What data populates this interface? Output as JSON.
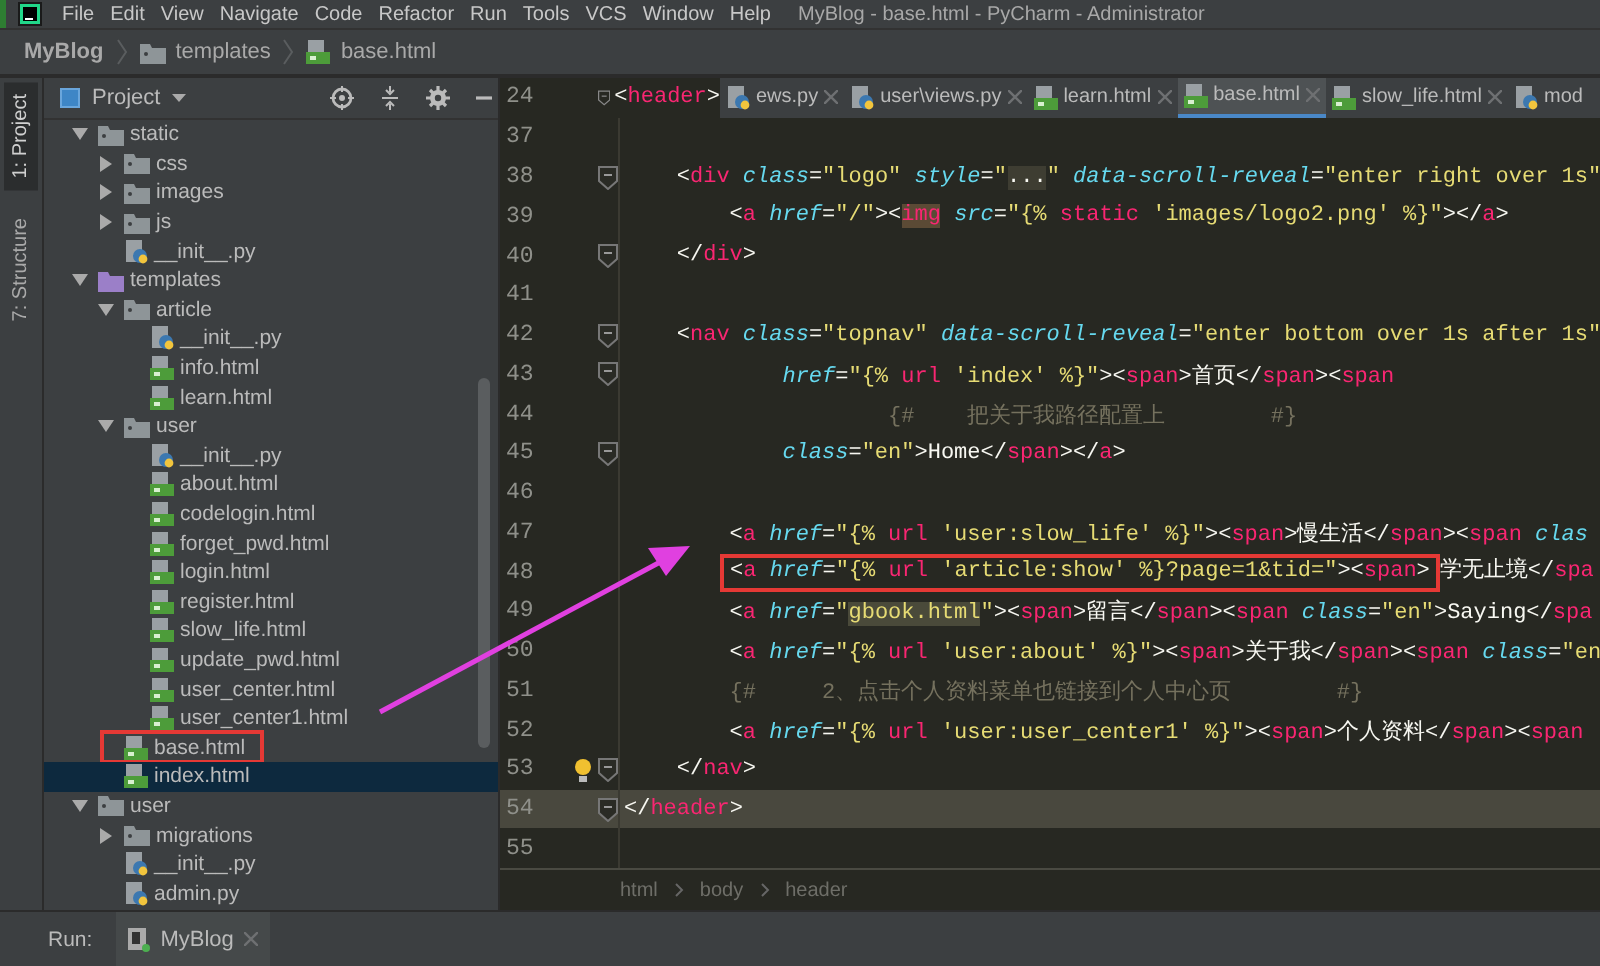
{
  "window": {
    "title": "MyBlog - base.html - PyCharm - Administrator"
  },
  "menu": [
    "File",
    "Edit",
    "View",
    "Navigate",
    "Code",
    "Refactor",
    "Run",
    "Tools",
    "VCS",
    "Window",
    "Help"
  ],
  "breadcrumb": [
    {
      "label": "MyBlog",
      "kind": "project"
    },
    {
      "label": "templates",
      "kind": "folder"
    },
    {
      "label": "base.html",
      "kind": "html"
    }
  ],
  "tool_stripe": [
    {
      "label": "1: Project",
      "selected": true
    },
    {
      "label": "7: Structure",
      "selected": false
    }
  ],
  "project_panel": {
    "title": "Project",
    "tree": [
      {
        "label": "static",
        "kind": "folder",
        "expanded": true,
        "selected": false,
        "marked": false,
        "children": [
          {
            "label": "css",
            "kind": "folder",
            "expanded": false,
            "selected": false,
            "marked": false
          },
          {
            "label": "images",
            "kind": "folder",
            "expanded": false,
            "selected": false,
            "marked": false
          },
          {
            "label": "js",
            "kind": "folder",
            "expanded": false,
            "selected": false,
            "marked": false
          },
          {
            "label": "__init__.py",
            "kind": "python",
            "selected": false,
            "marked": false
          }
        ]
      },
      {
        "label": "templates",
        "kind": "templates-folder",
        "expanded": true,
        "selected": false,
        "marked": false,
        "children": [
          {
            "label": "article",
            "kind": "folder",
            "expanded": true,
            "selected": false,
            "marked": false,
            "children": [
              {
                "label": "__init__.py",
                "kind": "python",
                "selected": false,
                "marked": false
              },
              {
                "label": "info.html",
                "kind": "html",
                "selected": false,
                "marked": false
              },
              {
                "label": "learn.html",
                "kind": "html",
                "selected": false,
                "marked": false
              }
            ]
          },
          {
            "label": "user",
            "kind": "folder",
            "expanded": true,
            "selected": false,
            "marked": false,
            "children": [
              {
                "label": "__init__.py",
                "kind": "python",
                "selected": false,
                "marked": false
              },
              {
                "label": "about.html",
                "kind": "html",
                "selected": false,
                "marked": false
              },
              {
                "label": "codelogin.html",
                "kind": "html",
                "selected": false,
                "marked": false
              },
              {
                "label": "forget_pwd.html",
                "kind": "html",
                "selected": false,
                "marked": false
              },
              {
                "label": "login.html",
                "kind": "html",
                "selected": false,
                "marked": false
              },
              {
                "label": "register.html",
                "kind": "html",
                "selected": false,
                "marked": false
              },
              {
                "label": "slow_life.html",
                "kind": "html",
                "selected": false,
                "marked": false
              },
              {
                "label": "update_pwd.html",
                "kind": "html",
                "selected": false,
                "marked": false
              },
              {
                "label": "user_center.html",
                "kind": "html",
                "selected": false,
                "marked": false
              },
              {
                "label": "user_center1.html",
                "kind": "html",
                "selected": false,
                "marked": false
              }
            ]
          },
          {
            "label": "base.html",
            "kind": "html",
            "selected": false,
            "marked": true
          },
          {
            "label": "index.html",
            "kind": "html",
            "selected": true,
            "marked": false
          }
        ]
      },
      {
        "label": "user",
        "kind": "folder",
        "expanded": true,
        "selected": false,
        "marked": false,
        "children": [
          {
            "label": "migrations",
            "kind": "folder",
            "expanded": false,
            "selected": false,
            "marked": false
          },
          {
            "label": "__init__.py",
            "kind": "python",
            "selected": false,
            "marked": false
          },
          {
            "label": "admin.py",
            "kind": "python",
            "selected": false,
            "marked": false
          }
        ]
      }
    ]
  },
  "editor": {
    "sticky_line": {
      "number": "24",
      "tokens": [
        {
          "kind": "punct",
          "text": "<"
        },
        {
          "kind": "tag",
          "text": "header"
        },
        {
          "kind": "punct",
          "text": ">"
        }
      ]
    },
    "tabs": [
      {
        "label": "ews.py",
        "kind": "python",
        "selected": false,
        "closable": true
      },
      {
        "label": "user\\views.py",
        "kind": "python",
        "selected": false,
        "closable": true
      },
      {
        "label": "learn.html",
        "kind": "html",
        "selected": false,
        "closable": true
      },
      {
        "label": "base.html",
        "kind": "html",
        "selected": true,
        "closable": true
      },
      {
        "label": "slow_life.html",
        "kind": "html",
        "selected": false,
        "closable": true
      },
      {
        "label": "mod",
        "kind": "python",
        "selected": false,
        "closable": false
      }
    ],
    "lines": [
      {
        "number": "37",
        "fold": false,
        "bulb": false,
        "current": false
      },
      {
        "number": "38",
        "fold": true,
        "bulb": false,
        "current": false,
        "tokens": [
          {
            "kind": "punct",
            "text": "    <"
          },
          {
            "kind": "tag",
            "text": "div "
          },
          {
            "kind": "attr",
            "text": "class"
          },
          {
            "kind": "punct",
            "text": "="
          },
          {
            "kind": "string",
            "text": "\"logo\" "
          },
          {
            "kind": "attr",
            "text": "style"
          },
          {
            "kind": "punct",
            "text": "="
          },
          {
            "kind": "string",
            "text": "\""
          },
          {
            "kind": "folded",
            "text": "..."
          },
          {
            "kind": "string",
            "text": "\" "
          },
          {
            "kind": "attr",
            "text": "data-scroll-reveal"
          },
          {
            "kind": "punct",
            "text": "="
          },
          {
            "kind": "string",
            "text": "\"enter right over 1s\""
          }
        ]
      },
      {
        "number": "39",
        "fold": false,
        "bulb": false,
        "current": false,
        "tokens": [
          {
            "kind": "punct",
            "text": "        <"
          },
          {
            "kind": "tag",
            "text": "a "
          },
          {
            "kind": "attr",
            "text": "href"
          },
          {
            "kind": "punct",
            "text": "="
          },
          {
            "kind": "string",
            "text": "\"/\""
          },
          {
            "kind": "punct",
            "text": "><"
          },
          {
            "kind": "tag-marked",
            "text": "img"
          },
          {
            "kind": "attr",
            "text": " src"
          },
          {
            "kind": "punct",
            "text": "="
          },
          {
            "kind": "string",
            "text": "\"{% "
          },
          {
            "kind": "tag",
            "text": "static "
          },
          {
            "kind": "string",
            "text": "'images/logo2.png' %}\""
          },
          {
            "kind": "punct",
            "text": "></"
          },
          {
            "kind": "tag",
            "text": "a"
          },
          {
            "kind": "punct",
            "text": ">"
          }
        ]
      },
      {
        "number": "40",
        "fold": true,
        "bulb": false,
        "current": false,
        "tokens": [
          {
            "kind": "punct",
            "text": "    </"
          },
          {
            "kind": "tag",
            "text": "div"
          },
          {
            "kind": "punct",
            "text": ">"
          }
        ]
      },
      {
        "number": "41",
        "fold": false,
        "bulb": false,
        "current": false
      },
      {
        "number": "42",
        "fold": true,
        "bulb": false,
        "current": false,
        "tokens": [
          {
            "kind": "punct",
            "text": "    <"
          },
          {
            "kind": "tag",
            "text": "nav "
          },
          {
            "kind": "attr",
            "text": "class"
          },
          {
            "kind": "punct",
            "text": "="
          },
          {
            "kind": "string",
            "text": "\"topnav\" "
          },
          {
            "kind": "attr",
            "text": "data-scroll-reveal"
          },
          {
            "kind": "punct",
            "text": "="
          },
          {
            "kind": "string",
            "text": "\"enter bottom over 1s after 1s\""
          }
        ]
      },
      {
        "number": "43",
        "fold": true,
        "bulb": false,
        "current": false,
        "tokens": [
          {
            "kind": "attr",
            "text": "            href"
          },
          {
            "kind": "punct",
            "text": "="
          },
          {
            "kind": "string",
            "text": "\"{% "
          },
          {
            "kind": "tag",
            "text": "url "
          },
          {
            "kind": "string",
            "text": "'index' %}\""
          },
          {
            "kind": "punct",
            "text": "><"
          },
          {
            "kind": "tag",
            "text": "span"
          },
          {
            "kind": "punct",
            "text": ">"
          },
          {
            "kind": "text",
            "text": "首页"
          },
          {
            "kind": "punct",
            "text": "</"
          },
          {
            "kind": "tag",
            "text": "span"
          },
          {
            "kind": "punct",
            "text": "><"
          },
          {
            "kind": "tag",
            "text": "span"
          }
        ]
      },
      {
        "number": "44",
        "fold": false,
        "bulb": false,
        "current": false,
        "tokens": [
          {
            "kind": "comment",
            "text": "                    {#    把关于我路径配置上        #}"
          }
        ]
      },
      {
        "number": "45",
        "fold": true,
        "bulb": false,
        "current": false,
        "tokens": [
          {
            "kind": "attr",
            "text": "            class"
          },
          {
            "kind": "punct",
            "text": "="
          },
          {
            "kind": "string",
            "text": "\"en\""
          },
          {
            "kind": "punct",
            "text": ">"
          },
          {
            "kind": "text",
            "text": "Home"
          },
          {
            "kind": "punct",
            "text": "</"
          },
          {
            "kind": "tag",
            "text": "span"
          },
          {
            "kind": "punct",
            "text": "></"
          },
          {
            "kind": "tag",
            "text": "a"
          },
          {
            "kind": "punct",
            "text": ">"
          }
        ]
      },
      {
        "number": "46",
        "fold": false,
        "bulb": false,
        "current": false
      },
      {
        "number": "47",
        "fold": false,
        "bulb": false,
        "current": false,
        "tokens": [
          {
            "kind": "punct",
            "text": "        <"
          },
          {
            "kind": "tag",
            "text": "a "
          },
          {
            "kind": "attr",
            "text": "href"
          },
          {
            "kind": "punct",
            "text": "="
          },
          {
            "kind": "string",
            "text": "\"{% "
          },
          {
            "kind": "tag",
            "text": "url "
          },
          {
            "kind": "string",
            "text": "'user:slow_life' %}\""
          },
          {
            "kind": "punct",
            "text": "><"
          },
          {
            "kind": "tag",
            "text": "span"
          },
          {
            "kind": "punct",
            "text": ">"
          },
          {
            "kind": "text",
            "text": "慢生活"
          },
          {
            "kind": "punct",
            "text": "</"
          },
          {
            "kind": "tag",
            "text": "span"
          },
          {
            "kind": "punct",
            "text": "><"
          },
          {
            "kind": "tag",
            "text": "span "
          },
          {
            "kind": "attr",
            "text": "clas"
          }
        ]
      },
      {
        "number": "48",
        "fold": false,
        "bulb": false,
        "current": false,
        "tokens": [
          {
            "kind": "callout",
            "tokens": [
              {
                "kind": "punct",
                "text": "<"
              },
              {
                "kind": "tag",
                "text": "a "
              },
              {
                "kind": "attr",
                "text": "href"
              },
              {
                "kind": "punct",
                "text": "="
              },
              {
                "kind": "string",
                "text": "\"{% "
              },
              {
                "kind": "tag",
                "text": "url "
              },
              {
                "kind": "string",
                "text": "'article:show' %}?page=1&tid=\""
              },
              {
                "kind": "punct",
                "text": "><"
              },
              {
                "kind": "tag",
                "text": "span"
              },
              {
                "kind": "punct",
                "text": ">"
              }
            ]
          },
          {
            "kind": "text",
            "text": "学无止境"
          },
          {
            "kind": "punct",
            "text": "</"
          },
          {
            "kind": "tag",
            "text": "spa"
          }
        ]
      },
      {
        "number": "49",
        "fold": false,
        "bulb": false,
        "current": false,
        "tokens": [
          {
            "kind": "punct",
            "text": "        <"
          },
          {
            "kind": "tag",
            "text": "a "
          },
          {
            "kind": "attr",
            "text": "href"
          },
          {
            "kind": "punct",
            "text": "="
          },
          {
            "kind": "string",
            "text": "\""
          },
          {
            "kind": "string-marked",
            "text": "gbook.html"
          },
          {
            "kind": "string",
            "text": "\""
          },
          {
            "kind": "punct",
            "text": "><"
          },
          {
            "kind": "tag",
            "text": "span"
          },
          {
            "kind": "punct",
            "text": ">"
          },
          {
            "kind": "text",
            "text": "留言"
          },
          {
            "kind": "punct",
            "text": "</"
          },
          {
            "kind": "tag",
            "text": "span"
          },
          {
            "kind": "punct",
            "text": "><"
          },
          {
            "kind": "tag",
            "text": "span "
          },
          {
            "kind": "attr",
            "text": "class"
          },
          {
            "kind": "punct",
            "text": "="
          },
          {
            "kind": "string",
            "text": "\"en\""
          },
          {
            "kind": "punct",
            "text": ">"
          },
          {
            "kind": "text",
            "text": "Saying"
          },
          {
            "kind": "punct",
            "text": "</"
          },
          {
            "kind": "tag",
            "text": "spa"
          }
        ]
      },
      {
        "number": "50",
        "fold": false,
        "bulb": false,
        "current": false,
        "tokens": [
          {
            "kind": "punct",
            "text": "        <"
          },
          {
            "kind": "tag",
            "text": "a "
          },
          {
            "kind": "attr",
            "text": "href"
          },
          {
            "kind": "punct",
            "text": "="
          },
          {
            "kind": "string",
            "text": "\"{% "
          },
          {
            "kind": "tag",
            "text": "url "
          },
          {
            "kind": "string",
            "text": "'user:about' %}\""
          },
          {
            "kind": "punct",
            "text": "><"
          },
          {
            "kind": "tag",
            "text": "span"
          },
          {
            "kind": "punct",
            "text": ">"
          },
          {
            "kind": "text",
            "text": "关于我"
          },
          {
            "kind": "punct",
            "text": "</"
          },
          {
            "kind": "tag",
            "text": "span"
          },
          {
            "kind": "punct",
            "text": "><"
          },
          {
            "kind": "tag",
            "text": "span "
          },
          {
            "kind": "attr",
            "text": "class"
          },
          {
            "kind": "punct",
            "text": "="
          },
          {
            "kind": "string",
            "text": "\"en"
          }
        ]
      },
      {
        "number": "51",
        "fold": false,
        "bulb": false,
        "current": false,
        "tokens": [
          {
            "kind": "comment",
            "text": "        {#     2、点击个人资料菜单也链接到个人中心页        #}"
          }
        ]
      },
      {
        "number": "52",
        "fold": false,
        "bulb": false,
        "current": false,
        "tokens": [
          {
            "kind": "punct",
            "text": "        <"
          },
          {
            "kind": "tag",
            "text": "a "
          },
          {
            "kind": "attr",
            "text": "href"
          },
          {
            "kind": "punct",
            "text": "="
          },
          {
            "kind": "string",
            "text": "\"{% "
          },
          {
            "kind": "tag",
            "text": "url "
          },
          {
            "kind": "string",
            "text": "'user:user_center1' %}\""
          },
          {
            "kind": "punct",
            "text": "><"
          },
          {
            "kind": "tag",
            "text": "span"
          },
          {
            "kind": "punct",
            "text": ">"
          },
          {
            "kind": "text",
            "text": "个人资料"
          },
          {
            "kind": "punct",
            "text": "</"
          },
          {
            "kind": "tag",
            "text": "span"
          },
          {
            "kind": "punct",
            "text": "><"
          },
          {
            "kind": "tag",
            "text": "span"
          }
        ]
      },
      {
        "number": "53",
        "fold": true,
        "bulb": true,
        "current": false,
        "tokens": [
          {
            "kind": "punct",
            "text": "    </"
          },
          {
            "kind": "tag",
            "text": "nav"
          },
          {
            "kind": "punct",
            "text": ">"
          }
        ]
      },
      {
        "number": "54",
        "fold": true,
        "bulb": false,
        "current": true,
        "tokens": [
          {
            "kind": "punct",
            "text": "</"
          },
          {
            "kind": "tag",
            "text": "header"
          },
          {
            "kind": "punct",
            "text": ">"
          }
        ]
      },
      {
        "number": "55",
        "fold": false,
        "bulb": false,
        "current": false
      }
    ],
    "path": [
      "html",
      "body",
      "header"
    ]
  },
  "run_bar": {
    "label": "Run:",
    "tab": "MyBlog"
  }
}
